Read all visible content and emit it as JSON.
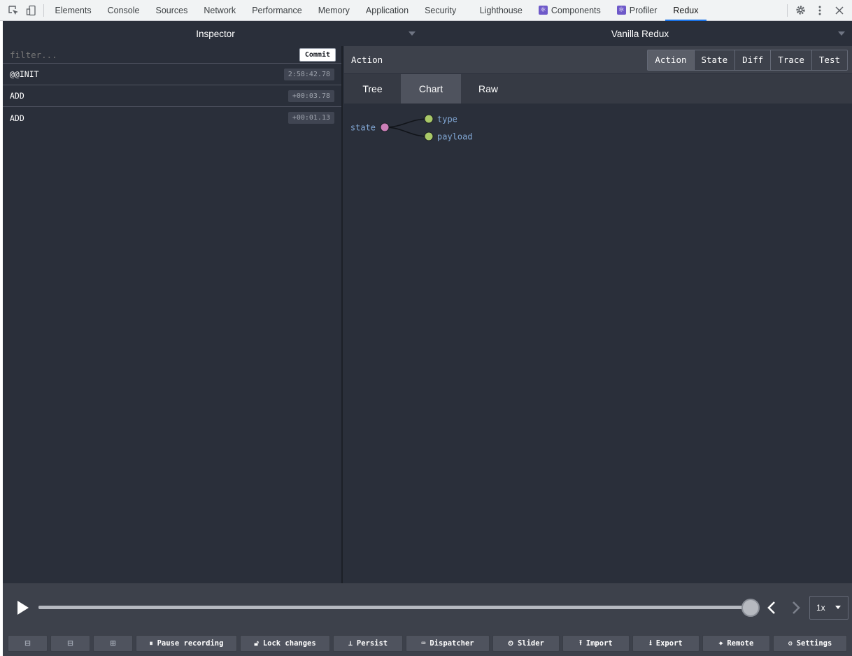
{
  "devtools": {
    "tabs": [
      "Elements",
      "Console",
      "Sources",
      "Network",
      "Performance",
      "Memory",
      "Application",
      "Security",
      "Lighthouse",
      "Components",
      "Profiler",
      "Redux"
    ],
    "active_tab": "Redux"
  },
  "top": {
    "monitor": "Inspector",
    "store": "Vanilla Redux"
  },
  "filter": {
    "placeholder": "filter...",
    "commit_label": "Commit"
  },
  "actions": [
    {
      "name": "@@INIT",
      "time": "2:58:42.78"
    },
    {
      "name": "ADD",
      "time": "+00:03.78"
    },
    {
      "name": "ADD",
      "time": "+00:01.13"
    }
  ],
  "inspector": {
    "header_title": "Action",
    "modes": [
      "Action",
      "State",
      "Diff",
      "Trace",
      "Test"
    ],
    "active_mode": "Action",
    "views": [
      "Tree",
      "Chart",
      "Raw"
    ],
    "active_view": "Chart"
  },
  "chart_data": {
    "type": "tree",
    "root": "state",
    "children": [
      "type",
      "payload"
    ],
    "colors": {
      "root": "#cc7fb8",
      "leaf": "#a9c868",
      "label": "#80a6d3"
    }
  },
  "footer": {
    "speed": "1x",
    "slider_position": 1.0,
    "buttons": [
      "Pause recording",
      "Lock changes",
      "Persist",
      "Dispatcher",
      "Slider",
      "Import",
      "Export",
      "Remote",
      "Settings"
    ]
  }
}
